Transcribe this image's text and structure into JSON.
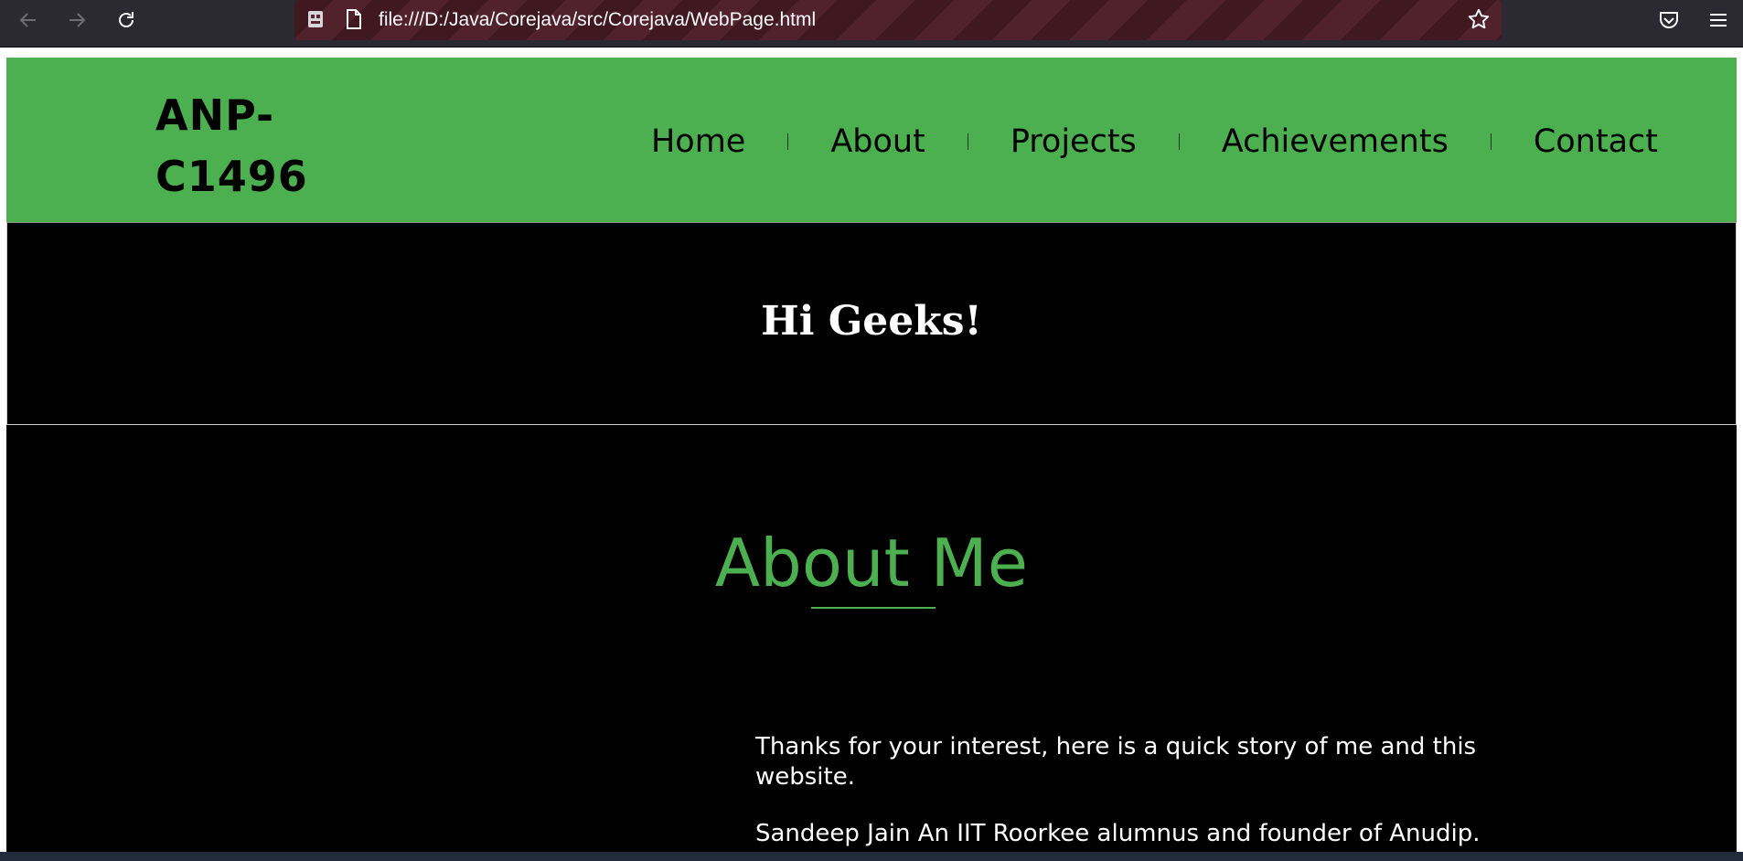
{
  "browser": {
    "url": "file:///D:/Java/Corejava/src/Corejava/WebPage.html",
    "icons": {
      "back": "arrow-left-icon",
      "forward": "arrow-right-icon",
      "reload": "reload-icon",
      "robot": "robot-icon",
      "page": "page-icon",
      "bookmark": "star-icon",
      "pocket": "pocket-icon",
      "menu": "hamburger-icon"
    }
  },
  "site": {
    "logo": {
      "line1": "ANP-",
      "line2": "C1496"
    },
    "nav": [
      "Home",
      "About",
      "Projects",
      "Achievements",
      "Contact"
    ],
    "hero_title": "Hi Geeks!",
    "about": {
      "title": "About Me",
      "paragraphs": [
        "Thanks for your interest, here is a quick story of me and this website.",
        "Sandeep Jain An IIT Roorkee alumnus and founder of Anudip."
      ]
    }
  },
  "colors": {
    "accent": "#4caf50",
    "header_bg": "#4caf50",
    "page_bg": "#000000",
    "hero_text": "#ffffff"
  }
}
